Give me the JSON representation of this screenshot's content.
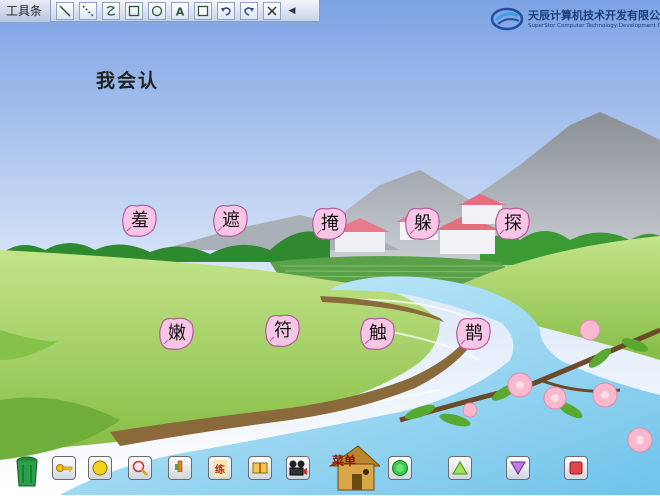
{
  "toolbar": {
    "title": "工具条",
    "tools": [
      "line-tool-icon",
      "dotted-line-tool-icon",
      "freehand-tool-icon",
      "rectangle-tool-icon",
      "ellipse-tool-icon",
      "text-tool-icon",
      "fill-tool-icon",
      "undo-icon",
      "redo-icon",
      "clear-icon"
    ],
    "text_tool_glyph": "A"
  },
  "logo": {
    "name_cn": "天辰计算机技术开发有限公司",
    "name_en": "SuperStor Computer Technology Development Co.,Ltd"
  },
  "lesson": {
    "heading": "我会认",
    "characters": [
      "羞",
      "遮",
      "掩",
      "躲",
      "探",
      "嫩",
      "符",
      "触",
      "鹊"
    ]
  },
  "bottom_bar": {
    "menu_label": "菜单",
    "practice_label": "练"
  },
  "colors": {
    "sky_top": "#7fa3e6",
    "sky_bottom": "#ffffff",
    "grass": "#9fce5a",
    "petal": "#f7c6e6",
    "river": "#8fd3f0"
  }
}
